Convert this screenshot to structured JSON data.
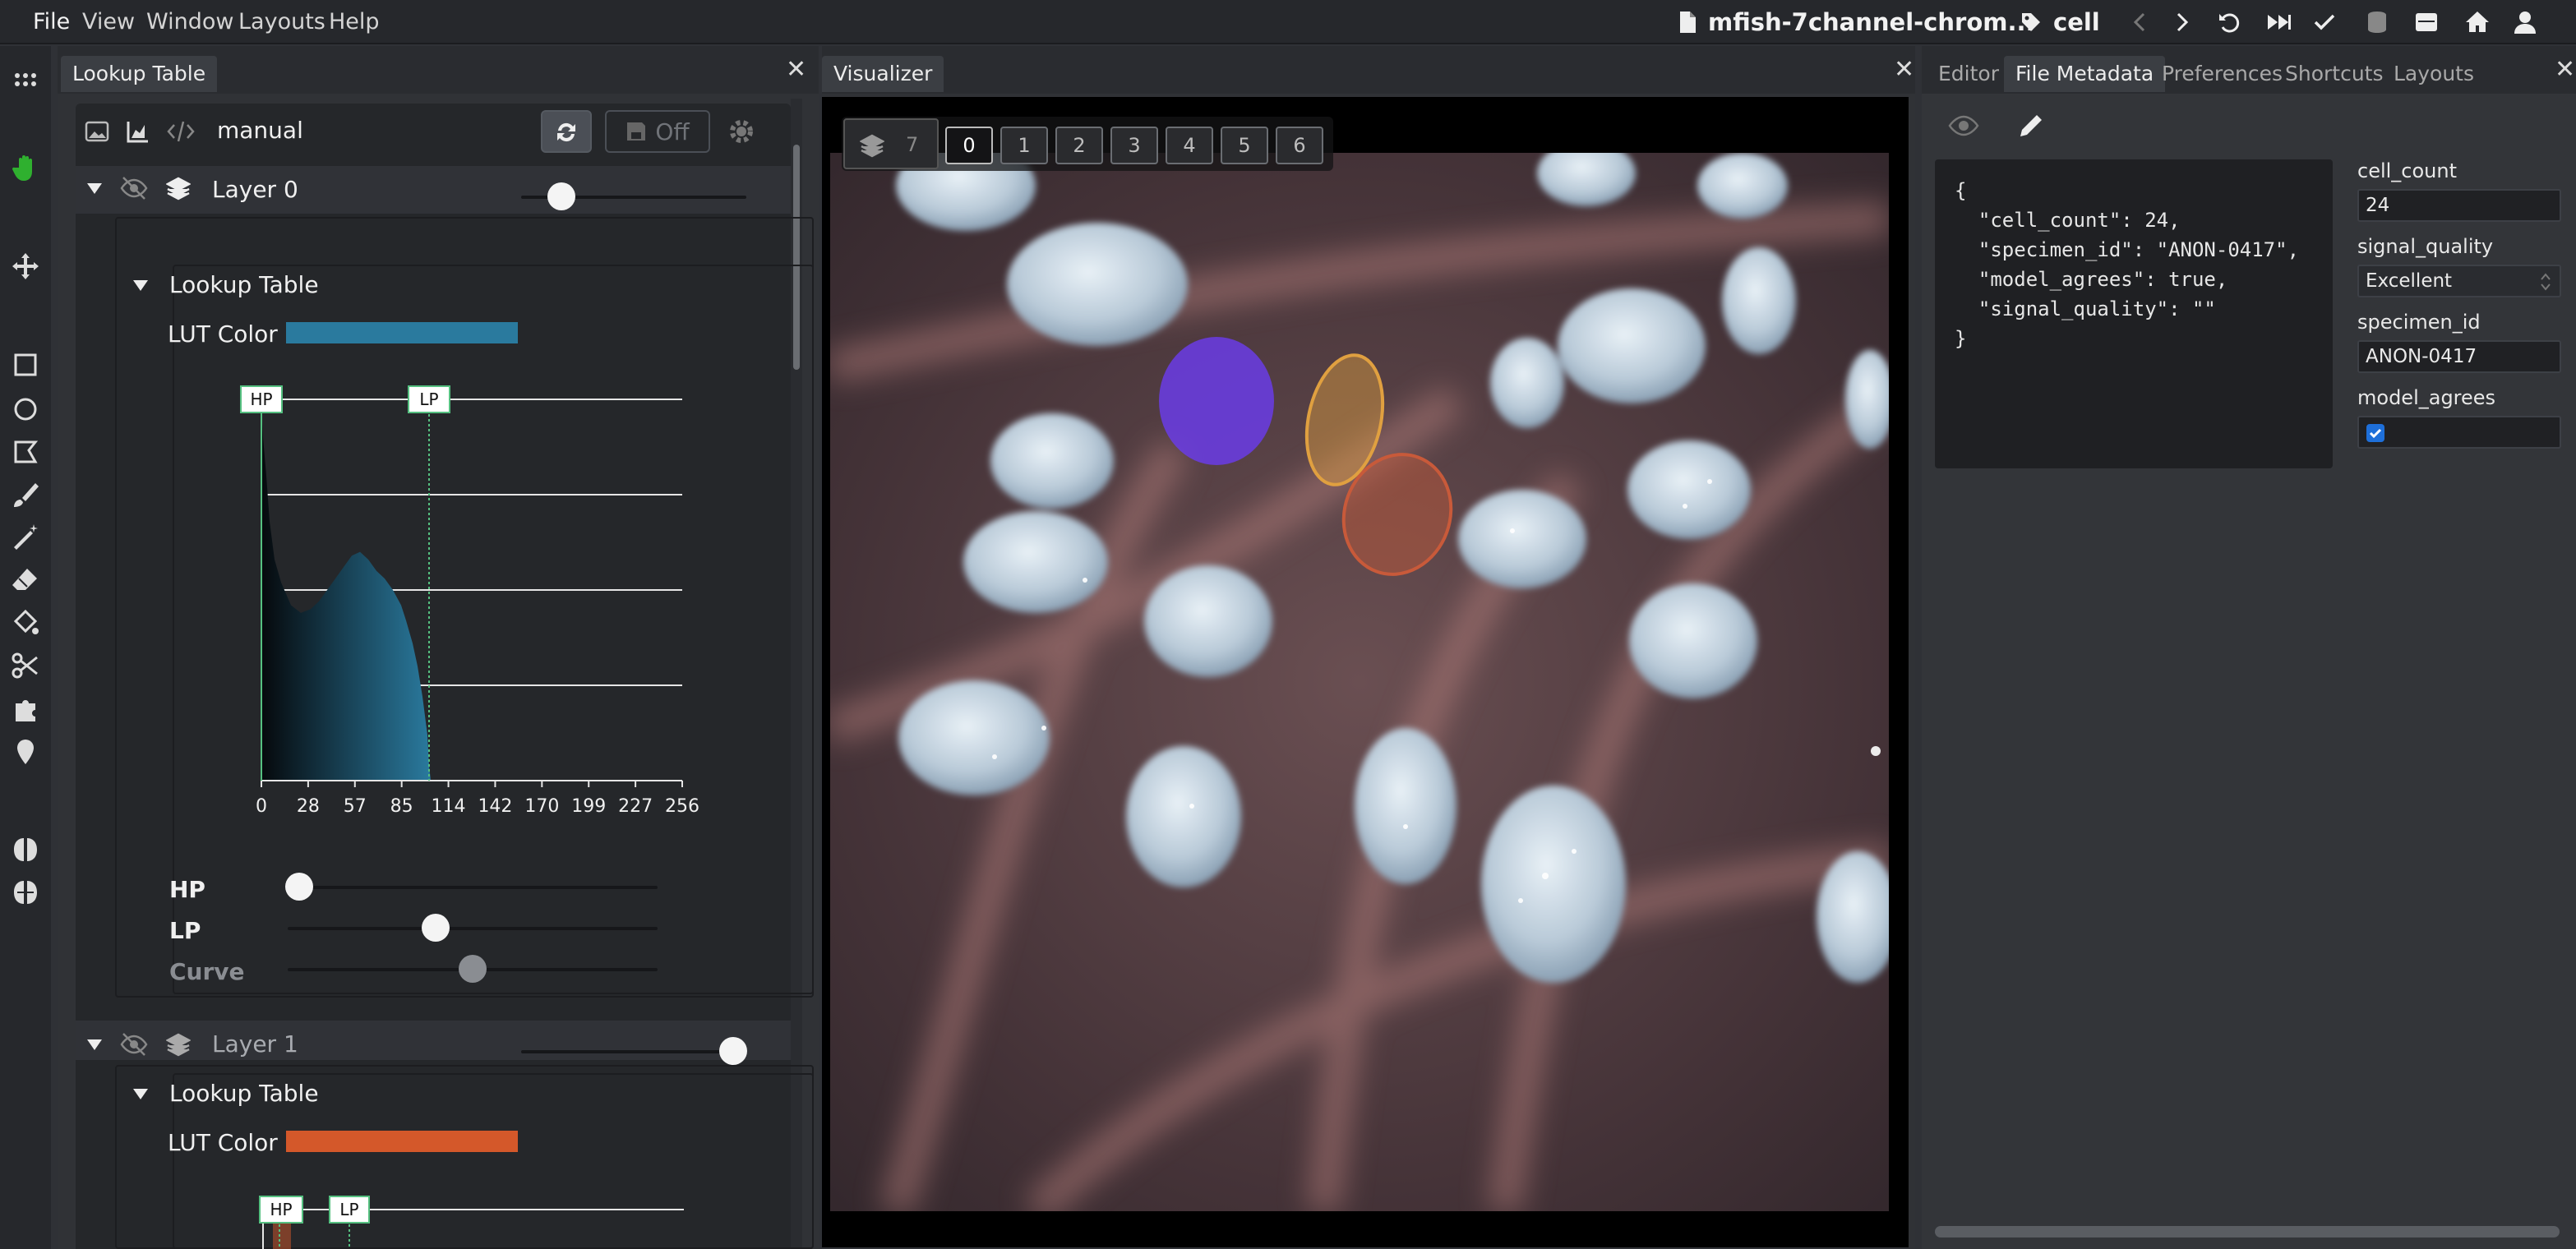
{
  "menubar": {
    "items": [
      "File",
      "View",
      "Window",
      "Layouts",
      "Help"
    ],
    "filename": "mfish-7channel-chrom...",
    "tag": "cell"
  },
  "lookup_panel": {
    "tab_title": "Lookup Table",
    "mode": "manual",
    "save_label": "Off",
    "layer0": {
      "name": "Layer 0",
      "opacity": 0.18,
      "section": "Lookup Table",
      "lut_label": "LUT Color",
      "lut_color": "#2a7a9e",
      "hp_tag": "HP",
      "lp_tag": "LP",
      "hp_label": "HP",
      "lp_label": "LP",
      "curve_label": "Curve",
      "hp_value": 0.03,
      "lp_value": 0.4,
      "curve_value": 0.5
    },
    "layer1": {
      "name": "Layer 1",
      "opacity": 0.94,
      "section": "Lookup Table",
      "lut_label": "LUT Color",
      "lut_color": "#d4582a",
      "hp_tag": "HP",
      "lp_tag": "LP"
    }
  },
  "chart_data": {
    "type": "area",
    "title": "",
    "xlabel": "",
    "ylabel": "",
    "x_ticks": [
      "0",
      "28",
      "57",
      "85",
      "114",
      "142",
      "170",
      "199",
      "227",
      "256"
    ],
    "xlim": [
      0,
      256
    ],
    "ylim": [
      0,
      1
    ],
    "grid": true,
    "series": [
      {
        "color": "#2a7a9e",
        "x": [
          0,
          1,
          3,
          5,
          8,
          12,
          18,
          24,
          30,
          35,
          40,
          45,
          50,
          55,
          60,
          65,
          70,
          75,
          80,
          85,
          88,
          92,
          95,
          98,
          101,
          102,
          103
        ],
        "y": [
          0.98,
          0.9,
          0.8,
          0.68,
          0.58,
          0.52,
          0.46,
          0.44,
          0.45,
          0.47,
          0.5,
          0.53,
          0.56,
          0.59,
          0.6,
          0.58,
          0.55,
          0.53,
          0.5,
          0.46,
          0.42,
          0.36,
          0.3,
          0.22,
          0.12,
          0.04,
          0.0
        ]
      }
    ],
    "markers": {
      "HP": 0,
      "LP": 102
    }
  },
  "visualizer": {
    "tab_title": "Visualizer",
    "layer_count": "7",
    "channels": [
      "0",
      "1",
      "2",
      "3",
      "4",
      "5",
      "6"
    ],
    "active_channel": "0"
  },
  "meta_panel": {
    "tabs": [
      "Editor",
      "File Metadata",
      "Preferences",
      "Shortcuts",
      "Layouts"
    ],
    "active_tab": "File Metadata",
    "json_lines": [
      "{",
      "  \"cell_count\": 24,",
      "  \"specimen_id\": \"ANON-0417\",",
      "  \"model_agrees\": true,",
      "  \"signal_quality\": \"\"",
      "}"
    ],
    "fields": {
      "cell_count_label": "cell_count",
      "cell_count": "24",
      "signal_quality_label": "signal_quality",
      "signal_quality": "Excellent",
      "specimen_id_label": "specimen_id",
      "specimen_id": "ANON-0417",
      "model_agrees_label": "model_agrees",
      "model_agrees": true
    }
  },
  "colors": {
    "accent": "#1e6fd9",
    "hand_tool": "#2fb02f",
    "annotation_purple": "#6a3ce6",
    "annotation_orange": "#e0a040",
    "annotation_red": "#c85a3a"
  }
}
